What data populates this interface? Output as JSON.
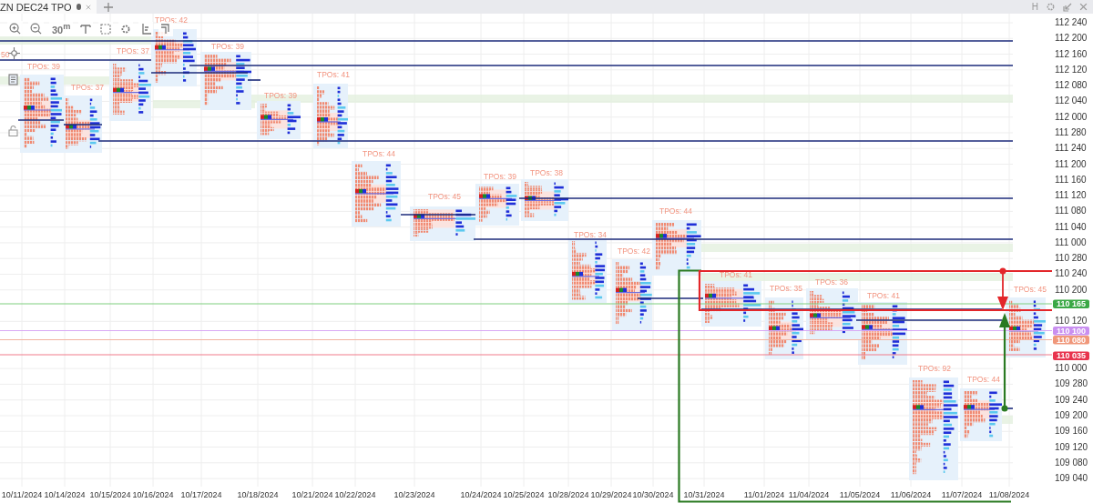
{
  "tab": {
    "title": "ZN DEC24 TPO",
    "modified": true
  },
  "window_controls": {
    "letter": "H"
  },
  "toolbar": {
    "timeframe": "30$^{m}$"
  },
  "edge_label": "50",
  "sessions": [
    {
      "label": "TPOs: 39"
    },
    {
      "label": "TPOs: 37"
    },
    {
      "label": "TPOs: 37"
    },
    {
      "label": "TPOs: 42"
    },
    {
      "label": "TPOs: 39"
    },
    {
      "label": "TPOs: 39"
    },
    {
      "label": "TPOs: 41"
    },
    {
      "label": "TPOs: 44"
    },
    {
      "label": "TPOs: 45"
    },
    {
      "label": "TPOs: 39"
    },
    {
      "label": "TPOs: 38"
    },
    {
      "label": "TPOs: 34"
    },
    {
      "label": "TPOs: 42"
    },
    {
      "label": "TPOs: 44"
    },
    {
      "label": "TPOs: 41"
    },
    {
      "label": "TPOs: 35"
    },
    {
      "label": "TPOs: 36"
    },
    {
      "label": "TPOs: 41"
    },
    {
      "label": "TPOs: 92"
    },
    {
      "label": "TPOs: 44"
    },
    {
      "label": "TPOs: 45"
    }
  ],
  "y_axis": [
    "112 240",
    "112 200",
    "112 160",
    "112 120",
    "112 080",
    "112 040",
    "112 000",
    "111 280",
    "111 240",
    "111 200",
    "111 160",
    "111 120",
    "111 080",
    "111 040",
    "111 000",
    "110 280",
    "110 240",
    "110 200",
    "110 120",
    "110 000",
    "109 280",
    "109 240",
    "109 200",
    "109 160",
    "109 120",
    "109 080",
    "109 040"
  ],
  "price_tags": [
    {
      "text": "110 165",
      "color": "#3aa845"
    },
    {
      "text": "110 100",
      "color": "#c98ff0"
    },
    {
      "text": "110 080",
      "color": "#f0977a"
    },
    {
      "text": "110 035",
      "color": "#e8344e"
    }
  ],
  "dates": [
    "10/11/2024",
    "10/14/2024",
    "10/15/2024",
    "10/16/2024",
    "10/17/2024",
    "10/18/2024",
    "10/21/2024",
    "10/22/2024",
    "10/23/2024",
    "10/24/2024",
    "10/25/2024",
    "10/28/2024",
    "10/29/2024",
    "10/30/2024",
    "10/31/2024",
    "11/01/2024",
    "11/04/2024",
    "11/05/2024",
    "11/06/2024",
    "11/07/2024",
    "11/08/2024"
  ]
}
